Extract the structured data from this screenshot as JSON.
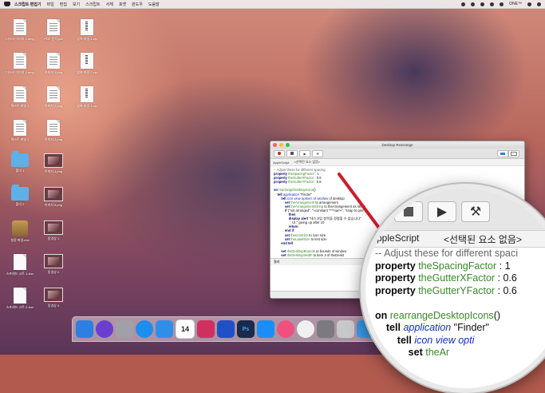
{
  "menubar": {
    "app_name": "스크립트 편집기",
    "items": [
      "파일",
      "편집",
      "보기",
      "스크립트",
      "서체",
      "포맷",
      "윈도우",
      "도움말"
    ],
    "right_items": [
      "ONE™"
    ]
  },
  "desktop_icons": [
    {
      "label": "디스크 이미지 1.dmg",
      "kind": "doc"
    },
    {
      "label": "PDF 문서.pdf",
      "kind": "doc"
    },
    {
      "label": "압축 파일 1.zip",
      "kind": "zip"
    },
    {
      "label": "디스크 이미지 2.dmg",
      "kind": "doc"
    },
    {
      "label": "이미지 1.png",
      "kind": "doc"
    },
    {
      "label": "압축 파일 2.zip",
      "kind": "zip"
    },
    {
      "label": "텍스트 파일 1",
      "kind": "doc"
    },
    {
      "label": "이미지 2.png",
      "kind": "doc"
    },
    {
      "label": "압축 파일 3.zip",
      "kind": "zip"
    },
    {
      "label": "텍스트 파일 2",
      "kind": "doc"
    },
    {
      "label": "이미지 3.png",
      "kind": "doc"
    },
    {
      "label": "폴더 1",
      "kind": "folder"
    },
    {
      "label": "이미지 4.png",
      "kind": "thumb"
    },
    {
      "label": "폴더 2",
      "kind": "folder"
    },
    {
      "label": "이미지 5.png",
      "kind": "thumb"
    },
    {
      "label": "설정 파일.exe",
      "kind": "app"
    },
    {
      "label": "동영상 1",
      "kind": "thumb"
    },
    {
      "label": "스프레드 시트 1.xlsx",
      "kind": "white"
    },
    {
      "label": "동영상 2",
      "kind": "thumb"
    },
    {
      "label": "스프레드 시트 2.xlsx",
      "kind": "white"
    },
    {
      "label": "동영상 3",
      "kind": "thumb"
    }
  ],
  "window": {
    "title": "Desktop Rearrange",
    "nav_language": "AppleScript",
    "nav_element": "<선택된 요소 없음>",
    "result_label": "결과",
    "code_lines": [
      {
        "parts": [
          {
            "t": "-- Adjust these for different spacing",
            "c": "c-comment"
          }
        ]
      },
      {
        "parts": [
          {
            "t": "property ",
            "c": "c-kw"
          },
          {
            "t": "theSpacingFactor",
            "c": "c-var"
          },
          {
            "t": " : 1",
            "c": ""
          }
        ]
      },
      {
        "parts": [
          {
            "t": "property ",
            "c": "c-kw"
          },
          {
            "t": "theGutterXFactor",
            "c": "c-var"
          },
          {
            "t": " : 0.6",
            "c": ""
          }
        ]
      },
      {
        "parts": [
          {
            "t": "property ",
            "c": "c-kw"
          },
          {
            "t": "theGutterYFactor",
            "c": "c-var"
          },
          {
            "t": " : 0.6",
            "c": ""
          }
        ]
      },
      {
        "parts": [
          {
            "t": "",
            "c": ""
          }
        ]
      },
      {
        "parts": [
          {
            "t": "on ",
            "c": "c-kw"
          },
          {
            "t": "rearrangeDesktopIcons",
            "c": "c-var"
          },
          {
            "t": "()",
            "c": ""
          }
        ]
      },
      {
        "parts": [
          {
            "t": "    tell ",
            "c": "c-kw"
          },
          {
            "t": "application",
            "c": "c-app"
          },
          {
            "t": " \"Finder\"",
            "c": ""
          }
        ]
      },
      {
        "parts": [
          {
            "t": "        tell ",
            "c": "c-kw"
          },
          {
            "t": "icon view options of window",
            "c": "c-app"
          },
          {
            "t": " of desktop",
            "c": ""
          }
        ]
      },
      {
        "parts": [
          {
            "t": "            set ",
            "c": "c-kw"
          },
          {
            "t": "theArrangement",
            "c": "c-var"
          },
          {
            "t": " to arrangement",
            "c": ""
          }
        ]
      },
      {
        "parts": [
          {
            "t": "            set ",
            "c": "c-kw"
          },
          {
            "t": "theArrangementString",
            "c": "c-var"
          },
          {
            "t": " to theArrangement as string",
            "c": ""
          }
        ]
      },
      {
        "parts": [
          {
            "t": "            if ",
            "c": "c-kw"
          },
          {
            "t": "{\"not arranged\", \"«constant ****narr»\", \"snap to grid\"}",
            "c": ""
          }
        ]
      },
      {
        "parts": [
          {
            "t": "                then",
            "c": "c-kw"
          }
        ]
      },
      {
        "parts": [
          {
            "t": "                display alert ",
            "c": "c-kw"
          },
          {
            "t": "\"데스크탑 항목을 정렬할 수 없습니다\"",
            "c": ""
          }
        ]
      },
      {
        "parts": [
          {
            "t": "                    UI.\" giving up after 10",
            "c": ""
          }
        ]
      },
      {
        "parts": [
          {
            "t": "                return",
            "c": "c-kw"
          }
        ]
      },
      {
        "parts": [
          {
            "t": "            end if",
            "c": "c-kw"
          }
        ]
      },
      {
        "parts": [
          {
            "t": "            set ",
            "c": "c-kw"
          },
          {
            "t": "theIconSize",
            "c": "c-var"
          },
          {
            "t": " to icon size",
            "c": ""
          }
        ]
      },
      {
        "parts": [
          {
            "t": "            set ",
            "c": "c-kw"
          },
          {
            "t": "theLabelSize",
            "c": "c-var"
          },
          {
            "t": " to text size",
            "c": ""
          }
        ]
      },
      {
        "parts": [
          {
            "t": "        end tell",
            "c": "c-kw"
          }
        ]
      },
      {
        "parts": [
          {
            "t": "",
            "c": ""
          }
        ]
      },
      {
        "parts": [
          {
            "t": "        set ",
            "c": "c-kw"
          },
          {
            "t": "theDesktopBounds",
            "c": "c-var"
          },
          {
            "t": " to bounds of window",
            "c": ""
          }
        ]
      },
      {
        "parts": [
          {
            "t": "        set ",
            "c": "c-kw"
          },
          {
            "t": "theDesktopWidth",
            "c": "c-var"
          },
          {
            "t": " to item 3 of theDeskt",
            "c": ""
          }
        ]
      }
    ]
  },
  "magnifier": {
    "nav_language": "AppleScript",
    "nav_element": "<선택된 요소 없음>",
    "code_lines": [
      {
        "parts": [
          {
            "t": "-- Adjust these for different spaci",
            "c": "c-comment"
          }
        ]
      },
      {
        "parts": [
          {
            "t": "property ",
            "c": "c-kw"
          },
          {
            "t": "theSpacingFactor",
            "c": "c-var"
          },
          {
            "t": " : 1",
            "c": ""
          }
        ]
      },
      {
        "parts": [
          {
            "t": "property ",
            "c": "c-kw"
          },
          {
            "t": "theGutterXFactor",
            "c": "c-var"
          },
          {
            "t": " : 0.6",
            "c": ""
          }
        ]
      },
      {
        "parts": [
          {
            "t": "property ",
            "c": "c-kw"
          },
          {
            "t": "theGutterYFactor",
            "c": "c-var"
          },
          {
            "t": " : 0.6",
            "c": ""
          }
        ]
      },
      {
        "parts": [
          {
            "t": "",
            "c": ""
          }
        ]
      },
      {
        "parts": [
          {
            "t": "on ",
            "c": "c-kw"
          },
          {
            "t": "rearrangeDesktopIcons",
            "c": "c-var"
          },
          {
            "t": "()",
            "c": ""
          }
        ]
      },
      {
        "parts": [
          {
            "t": "    tell ",
            "c": "c-kw"
          },
          {
            "t": "application",
            "c": "c-app"
          },
          {
            "t": " \"Finder\"",
            "c": ""
          }
        ]
      },
      {
        "parts": [
          {
            "t": "        tell ",
            "c": "c-kw"
          },
          {
            "t": "icon view opti",
            "c": "c-app"
          }
        ]
      },
      {
        "parts": [
          {
            "t": "            set ",
            "c": "c-kw"
          },
          {
            "t": "theAr",
            "c": "c-var"
          }
        ]
      }
    ]
  },
  "dock": {
    "items": [
      {
        "name": "finder-icon",
        "color": "#2d7fe0"
      },
      {
        "name": "siri-icon",
        "color": "#6a3fd0"
      },
      {
        "name": "launchpad-icon",
        "color": "#a0a0a8"
      },
      {
        "name": "safari-icon",
        "color": "#1d8ef0"
      },
      {
        "name": "tweetbot-icon",
        "color": "#2f8fe8"
      },
      {
        "name": "calendar-icon",
        "color": "#ffffff"
      },
      {
        "name": "speedtest-icon",
        "color": "#d03060"
      },
      {
        "name": "firebolt-icon",
        "color": "#2050c8"
      },
      {
        "name": "photoshop-icon",
        "color": "#1a2a4a"
      },
      {
        "name": "app-store-icon",
        "color": "#1a8ef5"
      },
      {
        "name": "itunes-icon",
        "color": "#f05080"
      },
      {
        "name": "photos-icon",
        "color": "#f0f0f0"
      },
      {
        "name": "system-preferences-icon",
        "color": "#7a7a80"
      },
      {
        "name": "script-editor-icon",
        "color": "#c8c8c8"
      },
      {
        "name": "mail-icon",
        "color": "#3a9ae8"
      }
    ],
    "calendar_day": "14",
    "photoshop_label": "Ps"
  }
}
